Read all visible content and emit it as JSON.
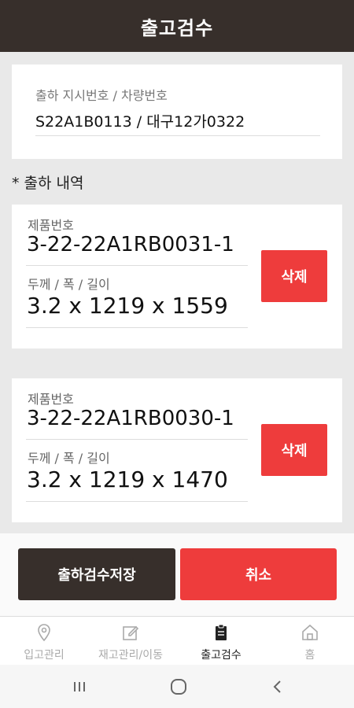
{
  "header": {
    "title": "출고검수"
  },
  "order": {
    "label": "출하 지시번호 / 차량번호",
    "value": "S22A1B0113 / 대구12가0322"
  },
  "section_title": "* 출하 내역",
  "items": [
    {
      "product_label": "제품번호",
      "product_no": "3-22-22A1RB0031-1",
      "dim_label": "두께 / 폭 / 길이",
      "dims": "3.2 x 1219 x 1559",
      "delete_label": "삭제"
    },
    {
      "product_label": "제품번호",
      "product_no": "3-22-22A1RB0030-1",
      "dim_label": "두께 / 폭 / 길이",
      "dims": "3.2 x 1219 x 1470",
      "delete_label": "삭제"
    }
  ],
  "actions": {
    "save_label": "출하검수저장",
    "cancel_label": "취소"
  },
  "tabs": [
    {
      "label": "입고관리",
      "icon": "location-pin-icon",
      "active": false
    },
    {
      "label": "재고관리/이동",
      "icon": "edit-icon",
      "active": false
    },
    {
      "label": "출고검수",
      "icon": "clipboard-icon",
      "active": true
    },
    {
      "label": "홈",
      "icon": "home-icon",
      "active": false
    }
  ],
  "system_nav": {
    "recent_icon": "recent-apps-icon",
    "home_icon": "home-circle-icon",
    "back_icon": "back-icon"
  },
  "colors": {
    "header": "#372f2b",
    "accent_red": "#ee3c3c",
    "background": "#e9e9e9"
  }
}
